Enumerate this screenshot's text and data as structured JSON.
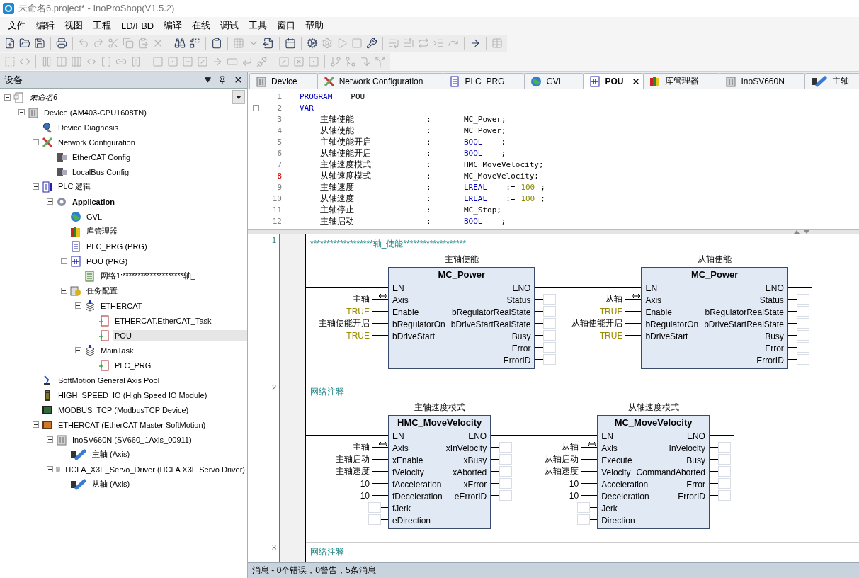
{
  "window": {
    "title": "未命名6.project* - InoProShop(V1.5.2)"
  },
  "menu": [
    "文件",
    "编辑",
    "视图",
    "工程",
    "LD/FBD",
    "编译",
    "在线",
    "调试",
    "工具",
    "窗口",
    "帮助"
  ],
  "toolbars": [
    {
      "items": [
        {
          "kind": "button",
          "disabled": false
        },
        {
          "kind": "button",
          "disabled": false
        },
        {
          "kind": "button",
          "disabled": false
        },
        {
          "kind": "separator"
        },
        {
          "kind": "button",
          "disabled": false
        },
        {
          "kind": "separator"
        },
        {
          "kind": "button",
          "disabled": true
        },
        {
          "kind": "button",
          "disabled": true
        },
        {
          "kind": "button",
          "disabled": true
        },
        {
          "kind": "button",
          "disabled": true
        },
        {
          "kind": "button",
          "disabled": true
        },
        {
          "kind": "button",
          "disabled": true
        },
        {
          "kind": "separator"
        },
        {
          "kind": "button",
          "disabled": false
        },
        {
          "kind": "button",
          "disabled": false
        },
        {
          "kind": "separator"
        },
        {
          "kind": "button",
          "disabled": false
        },
        {
          "kind": "separator"
        },
        {
          "kind": "button",
          "disabled": true
        },
        {
          "kind": "button",
          "disabled": true
        },
        {
          "kind": "button",
          "disabled": false
        },
        {
          "kind": "separator"
        },
        {
          "kind": "button",
          "disabled": false
        },
        {
          "kind": "separator"
        },
        {
          "kind": "button",
          "disabled": false
        },
        {
          "kind": "button",
          "disabled": true
        },
        {
          "kind": "button",
          "disabled": true
        },
        {
          "kind": "button",
          "disabled": true
        },
        {
          "kind": "button",
          "disabled": false
        },
        {
          "kind": "separator"
        },
        {
          "kind": "button",
          "disabled": true
        },
        {
          "kind": "button",
          "disabled": true
        },
        {
          "kind": "button",
          "disabled": true
        },
        {
          "kind": "button",
          "disabled": true
        },
        {
          "kind": "button",
          "disabled": true
        },
        {
          "kind": "separator"
        },
        {
          "kind": "button",
          "disabled": false
        },
        {
          "kind": "separator"
        },
        {
          "kind": "button",
          "disabled": true
        }
      ]
    },
    {
      "items": [
        {
          "kind": "button",
          "disabled": true
        },
        {
          "kind": "button",
          "disabled": true
        },
        {
          "kind": "separator"
        },
        {
          "kind": "button",
          "disabled": true
        },
        {
          "kind": "button",
          "disabled": true
        },
        {
          "kind": "button",
          "disabled": true
        },
        {
          "kind": "button",
          "disabled": true
        },
        {
          "kind": "button",
          "disabled": true
        },
        {
          "kind": "button",
          "disabled": true
        },
        {
          "kind": "button",
          "disabled": true
        },
        {
          "kind": "separator"
        },
        {
          "kind": "button",
          "disabled": true
        },
        {
          "kind": "button",
          "disabled": true
        },
        {
          "kind": "button",
          "disabled": true
        },
        {
          "kind": "button",
          "disabled": true
        },
        {
          "kind": "button",
          "disabled": true
        },
        {
          "kind": "button",
          "disabled": true
        },
        {
          "kind": "button",
          "disabled": true
        },
        {
          "kind": "button",
          "disabled": true
        },
        {
          "kind": "separator"
        },
        {
          "kind": "button",
          "disabled": true
        },
        {
          "kind": "button",
          "disabled": true
        },
        {
          "kind": "button",
          "disabled": true
        },
        {
          "kind": "separator"
        },
        {
          "kind": "button",
          "disabled": true
        },
        {
          "kind": "button",
          "disabled": true
        },
        {
          "kind": "button",
          "disabled": true
        },
        {
          "kind": "button",
          "disabled": true
        }
      ]
    }
  ],
  "devices_panel": {
    "title": "设备",
    "tree": [
      {
        "label": "未命名6",
        "kind": "project",
        "italic": true,
        "selected": false,
        "expanded": true,
        "children": [
          {
            "label": "Device (AM403-CPU1608TN)",
            "kind": "device",
            "selected": false,
            "expanded": true,
            "children": [
              {
                "label": "Device Diagnosis",
                "kind": "diagnosis",
                "selected": false
              },
              {
                "label": "Network Configuration",
                "kind": "network",
                "selected": false,
                "expanded": true,
                "children": [
                  {
                    "label": "EtherCAT Config",
                    "kind": "bus-config",
                    "selected": false
                  },
                  {
                    "label": "LocalBus Config",
                    "kind": "bus-config",
                    "selected": false
                  }
                ]
              },
              {
                "label": "PLC 逻辑",
                "kind": "plc",
                "selected": false,
                "expanded": true,
                "children": [
                  {
                    "label": "Application",
                    "kind": "app",
                    "bold": true,
                    "selected": false,
                    "expanded": true,
                    "children": [
                      {
                        "label": "GVL",
                        "kind": "globe",
                        "selected": false
                      },
                      {
                        "label": "库管理器",
                        "kind": "library",
                        "selected": false
                      },
                      {
                        "label": "PLC_PRG (PRG)",
                        "kind": "program",
                        "selected": false
                      },
                      {
                        "label": "POU (PRG)",
                        "kind": "fbd",
                        "selected": false,
                        "expanded": true,
                        "children": [
                          {
                            "label": "网络1:********************轴_",
                            "kind": "network-item",
                            "selected": false
                          }
                        ]
                      },
                      {
                        "label": "任务配置",
                        "kind": "task-config",
                        "selected": false,
                        "expanded": true,
                        "children": [
                          {
                            "label": "ETHERCAT",
                            "kind": "task",
                            "selected": false,
                            "expanded": true,
                            "children": [
                              {
                                "label": "ETHERCAT.EtherCAT_Task",
                                "kind": "task-call",
                                "selected": false
                              },
                              {
                                "label": "POU",
                                "kind": "task-call",
                                "selected": true
                              }
                            ]
                          },
                          {
                            "label": "MainTask",
                            "kind": "task",
                            "selected": false,
                            "expanded": true,
                            "children": [
                              {
                                "label": "PLC_PRG",
                                "kind": "task-call",
                                "selected": false
                              }
                            ]
                          }
                        ]
                      }
                    ]
                  }
                ]
              },
              {
                "label": "SoftMotion General Axis Pool",
                "kind": "axis-pool",
                "selected": false
              },
              {
                "label": "HIGH_SPEED_IO (High Speed IO Module)",
                "kind": "io-module",
                "selected": false
              },
              {
                "label": "MODBUS_TCP (ModbusTCP Device)",
                "kind": "modbus",
                "selected": false
              },
              {
                "label": "ETHERCAT (EtherCAT Master SoftMotion)",
                "kind": "ethercat",
                "selected": false,
                "expanded": true,
                "children": [
                  {
                    "label": "InoSV660N (SV660_1Axis_00911)",
                    "kind": "device",
                    "selected": false,
                    "expanded": true,
                    "children": [
                      {
                        "label": "主轴 (Axis)",
                        "kind": "axis",
                        "selected": false
                      }
                    ]
                  },
                  {
                    "label": "HCFA_X3E_Servo_Driver (HCFA X3E Servo Driver)",
                    "kind": "device",
                    "selected": false,
                    "expanded": true,
                    "children": [
                      {
                        "label": "从轴 (Axis)",
                        "kind": "axis",
                        "selected": false
                      }
                    ]
                  }
                ]
              }
            ]
          }
        ]
      }
    ]
  },
  "editor_tabs": [
    {
      "label": "Device",
      "kind": "device",
      "selected": false
    },
    {
      "label": "Network Configuration",
      "kind": "network",
      "selected": false
    },
    {
      "label": "PLC_PRG",
      "kind": "program",
      "selected": false
    },
    {
      "label": "GVL",
      "kind": "globe",
      "selected": false
    },
    {
      "label": "POU",
      "kind": "fbd",
      "selected": true
    },
    {
      "label": "库管理器",
      "kind": "library",
      "selected": false
    },
    {
      "label": "InoSV660N",
      "kind": "device",
      "selected": false
    },
    {
      "label": "主轴",
      "kind": "axis",
      "selected": false
    }
  ],
  "declarations": [
    {
      "number": "1",
      "kind": "code",
      "modified": false,
      "tokens": [
        {
          "text": "PROGRAM",
          "kind": "keyword"
        },
        {
          "text": "POU",
          "kind": "plain"
        }
      ]
    },
    {
      "number": "2",
      "kind": "code",
      "modified": false,
      "foldable": true,
      "tokens": [
        {
          "text": "VAR",
          "kind": "keyword"
        }
      ]
    },
    {
      "number": "3",
      "kind": "decl",
      "modified": false,
      "name": "主轴使能",
      "separator": ":",
      "tokens": [
        {
          "text": "MC_Power;",
          "kind": "plain"
        }
      ]
    },
    {
      "number": "4",
      "kind": "decl",
      "modified": false,
      "name": "从轴使能",
      "separator": ":",
      "tokens": [
        {
          "text": "MC_Power;",
          "kind": "plain"
        }
      ]
    },
    {
      "number": "5",
      "kind": "decl",
      "modified": false,
      "name": "主轴使能开启",
      "separator": ":",
      "tokens": [
        {
          "text": "BOOL",
          "kind": "keyword"
        },
        {
          "text": ";",
          "kind": "plain"
        }
      ]
    },
    {
      "number": "6",
      "kind": "decl",
      "modified": false,
      "name": "从轴使能开启",
      "separator": ":",
      "tokens": [
        {
          "text": "BOOL",
          "kind": "keyword"
        },
        {
          "text": ";",
          "kind": "plain"
        }
      ]
    },
    {
      "number": "7",
      "kind": "decl",
      "modified": false,
      "name": "主轴速度模式",
      "separator": ":",
      "tokens": [
        {
          "text": "HMC_MoveVelocity;",
          "kind": "plain"
        }
      ]
    },
    {
      "number": "8",
      "kind": "decl",
      "modified": true,
      "name": "从轴速度模式",
      "separator": ":",
      "tokens": [
        {
          "text": "MC_MoveVelocity;",
          "kind": "plain"
        }
      ]
    },
    {
      "number": "9",
      "kind": "decl",
      "modified": false,
      "name": "主轴速度",
      "separator": ":",
      "tokens": [
        {
          "text": "LREAL",
          "kind": "keyword"
        },
        {
          "text": ":=",
          "kind": "plain"
        },
        {
          "text": "100",
          "kind": "number"
        },
        {
          "text": ";",
          "kind": "plain"
        }
      ]
    },
    {
      "number": "10",
      "kind": "decl",
      "modified": false,
      "name": "从轴速度",
      "separator": ":",
      "tokens": [
        {
          "text": "LREAL",
          "kind": "keyword"
        },
        {
          "text": ":=",
          "kind": "plain"
        },
        {
          "text": "100",
          "kind": "number"
        },
        {
          "text": ";",
          "kind": "plain"
        }
      ]
    },
    {
      "number": "11",
      "kind": "decl",
      "modified": false,
      "name": "主轴停止",
      "separator": ":",
      "tokens": [
        {
          "text": "MC_Stop;",
          "kind": "plain"
        }
      ]
    },
    {
      "number": "12",
      "kind": "decl",
      "modified": false,
      "name": "主轴启动",
      "separator": ":",
      "tokens": [
        {
          "text": "BOOL",
          "kind": "keyword"
        },
        {
          "text": ";",
          "kind": "plain"
        }
      ]
    }
  ],
  "networks": [
    {
      "number": "1",
      "comment": "*******************轴_使能*******************",
      "blocks": [
        {
          "instance": "主轴使能",
          "type": "MC_Power",
          "en": "EN",
          "eno": "ENO",
          "inputs": [
            {
              "pin": "Axis",
              "value": "主轴",
              "kind": "plain",
              "inout": true
            },
            {
              "pin": "Enable",
              "value": "TRUE",
              "kind": "constant",
              "inout": false
            },
            {
              "pin": "bRegulatorOn",
              "value": "主轴使能开启",
              "kind": "plain",
              "inout": false
            },
            {
              "pin": "bDriveStart",
              "value": "TRUE",
              "kind": "constant",
              "inout": false
            }
          ],
          "outputs": [
            "Status",
            "bRegulatorRealState",
            "bDriveStartRealState",
            "Busy",
            "Error",
            "ErrorID"
          ]
        },
        {
          "instance": "从轴使能",
          "type": "MC_Power",
          "en": "EN",
          "eno": "ENO",
          "inputs": [
            {
              "pin": "Axis",
              "value": "从轴",
              "kind": "plain",
              "inout": true
            },
            {
              "pin": "Enable",
              "value": "TRUE",
              "kind": "constant",
              "inout": false
            },
            {
              "pin": "bRegulatorOn",
              "value": "从轴使能开启",
              "kind": "plain",
              "inout": false
            },
            {
              "pin": "bDriveStart",
              "value": "TRUE",
              "kind": "constant",
              "inout": false
            }
          ],
          "outputs": [
            "Status",
            "bRegulatorRealState",
            "bDriveStartRealState",
            "Busy",
            "Error",
            "ErrorID"
          ]
        }
      ]
    },
    {
      "number": "2",
      "comment": "网络注释",
      "blocks": [
        {
          "instance": "主轴速度模式",
          "type": "HMC_MoveVelocity",
          "en": "EN",
          "eno": "ENO",
          "inputs": [
            {
              "pin": "Axis",
              "value": "主轴",
              "kind": "plain",
              "inout": true
            },
            {
              "pin": "xEnable",
              "value": "主轴启动",
              "kind": "plain",
              "inout": false
            },
            {
              "pin": "fVelocity",
              "value": "主轴速度",
              "kind": "plain",
              "inout": false
            },
            {
              "pin": "fAcceleration",
              "value": "10",
              "kind": "plain",
              "inout": false
            },
            {
              "pin": "fDeceleration",
              "value": "10",
              "kind": "plain",
              "inout": false
            },
            {
              "pin": "fJerk",
              "kind": "empty",
              "inout": false
            },
            {
              "pin": "eDirection",
              "kind": "empty",
              "inout": false
            }
          ],
          "outputs": [
            "xInVelocity",
            "xBusy",
            "xAborted",
            "xError",
            "eErrorID"
          ]
        },
        {
          "instance": "从轴速度模式",
          "type": "MC_MoveVelocity",
          "en": "EN",
          "eno": "ENO",
          "inputs": [
            {
              "pin": "Axis",
              "value": "从轴",
              "kind": "plain",
              "inout": true
            },
            {
              "pin": "Execute",
              "value": "从轴启动",
              "kind": "plain",
              "inout": false
            },
            {
              "pin": "Velocity",
              "value": "从轴速度",
              "kind": "plain",
              "inout": false
            },
            {
              "pin": "Acceleration",
              "value": "10",
              "kind": "plain",
              "inout": false
            },
            {
              "pin": "Deceleration",
              "value": "10",
              "kind": "plain",
              "inout": false
            },
            {
              "pin": "Jerk",
              "kind": "empty",
              "inout": false
            },
            {
              "pin": "Direction",
              "kind": "empty",
              "inout": false
            }
          ],
          "outputs": [
            "InVelocity",
            "Busy",
            "CommandAborted",
            "Error",
            "ErrorID"
          ]
        }
      ]
    },
    {
      "number": "3",
      "comment": "网络注释"
    }
  ],
  "status_bar": "消息 - 0个错误，0警告，5条消息"
}
